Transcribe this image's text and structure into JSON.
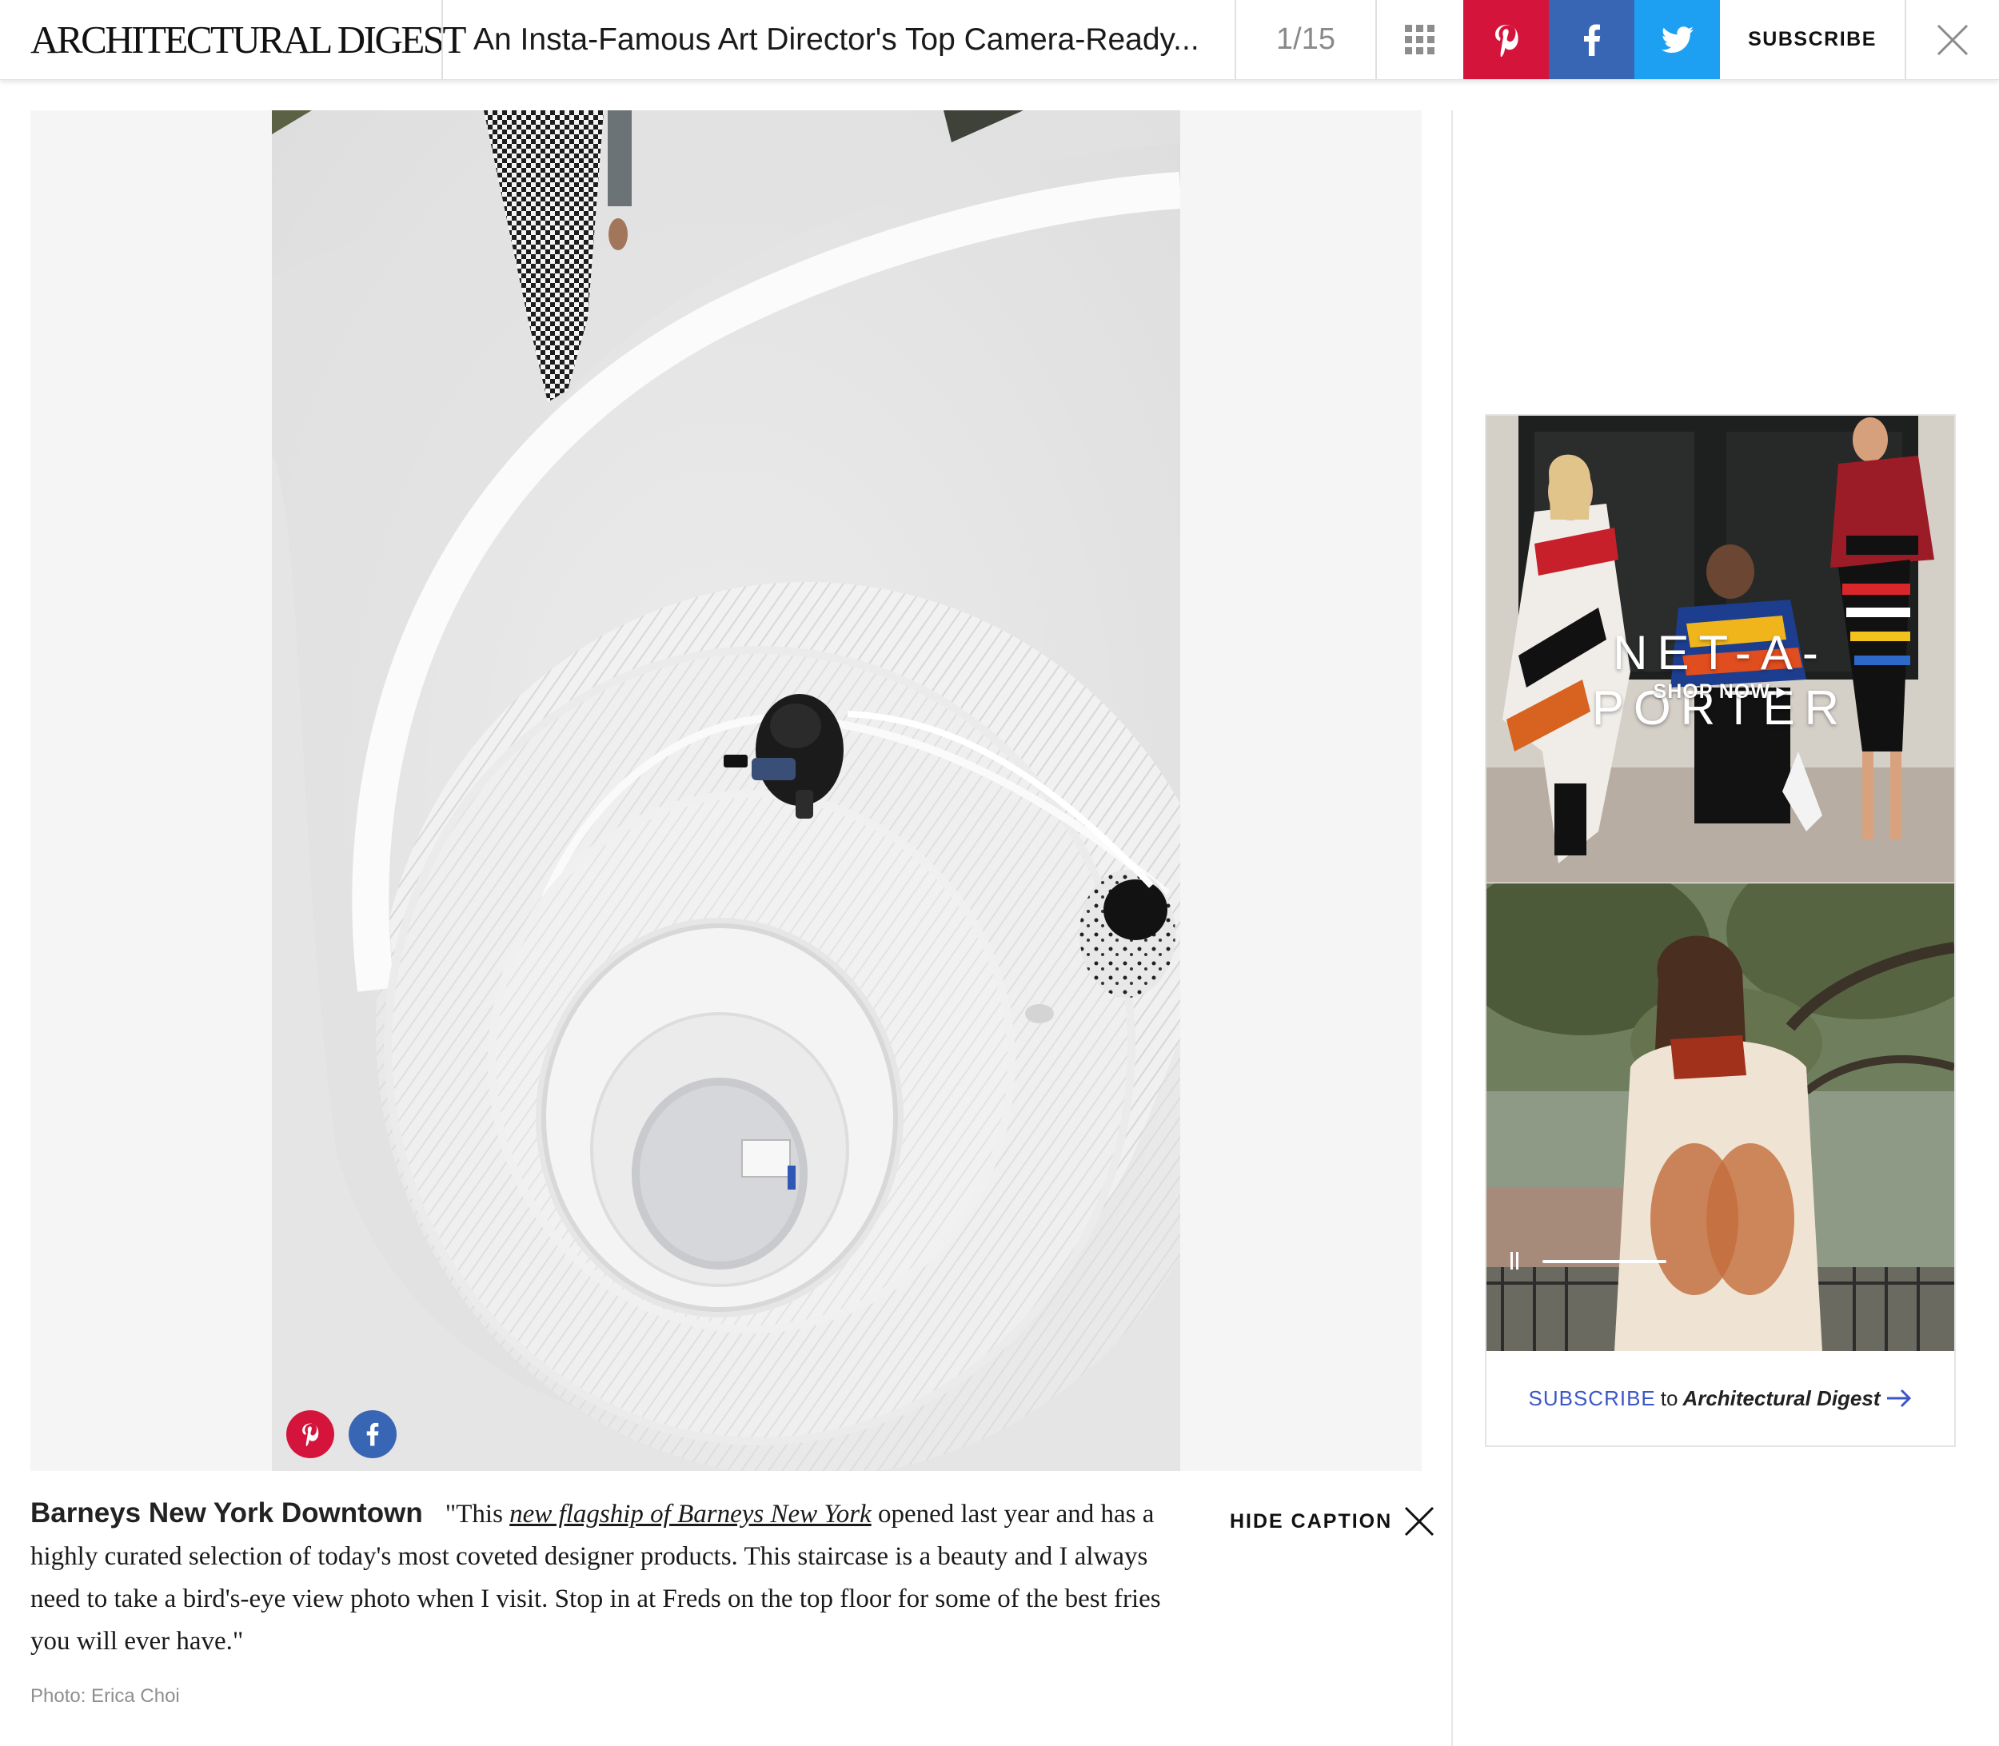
{
  "header": {
    "logo": "ARCHITECTURAL DIGEST",
    "gallery_title": "An Insta-Famous Art Director's Top Camera-Ready...",
    "counter": "1/15",
    "subscribe": "SUBSCRIBE"
  },
  "icons": {
    "grid": "grid-icon",
    "pinterest": "pinterest-icon",
    "facebook": "facebook-icon",
    "twitter": "twitter-icon",
    "close": "close-icon"
  },
  "colors": {
    "pinterest": "#d5143c",
    "facebook": "#3866b4",
    "twitter": "#1da0f1",
    "subscribe_accent": "#3d56c6"
  },
  "caption": {
    "title": "Barneys New York Downtown",
    "quote_open": "\"This ",
    "link_text": "new flagship of Barneys New York",
    "body": " opened last year and has a highly curated selection of today's most coveted designer products. This staircase is a beauty and I always need to take a bird's-eye view photo when I visit. Stop in at Freds on the top floor for some of the best fries you will ever have.\"",
    "hide_label": "HIDE CAPTION",
    "credit": "Photo: Erica Choi"
  },
  "ad": {
    "brand": "NET-A-PORTER",
    "cta": "SHOP NOW ▸",
    "subscribe_keyword": "SUBSCRIBE",
    "subscribe_to": "to",
    "subscribe_brand": "Architectural Digest"
  }
}
